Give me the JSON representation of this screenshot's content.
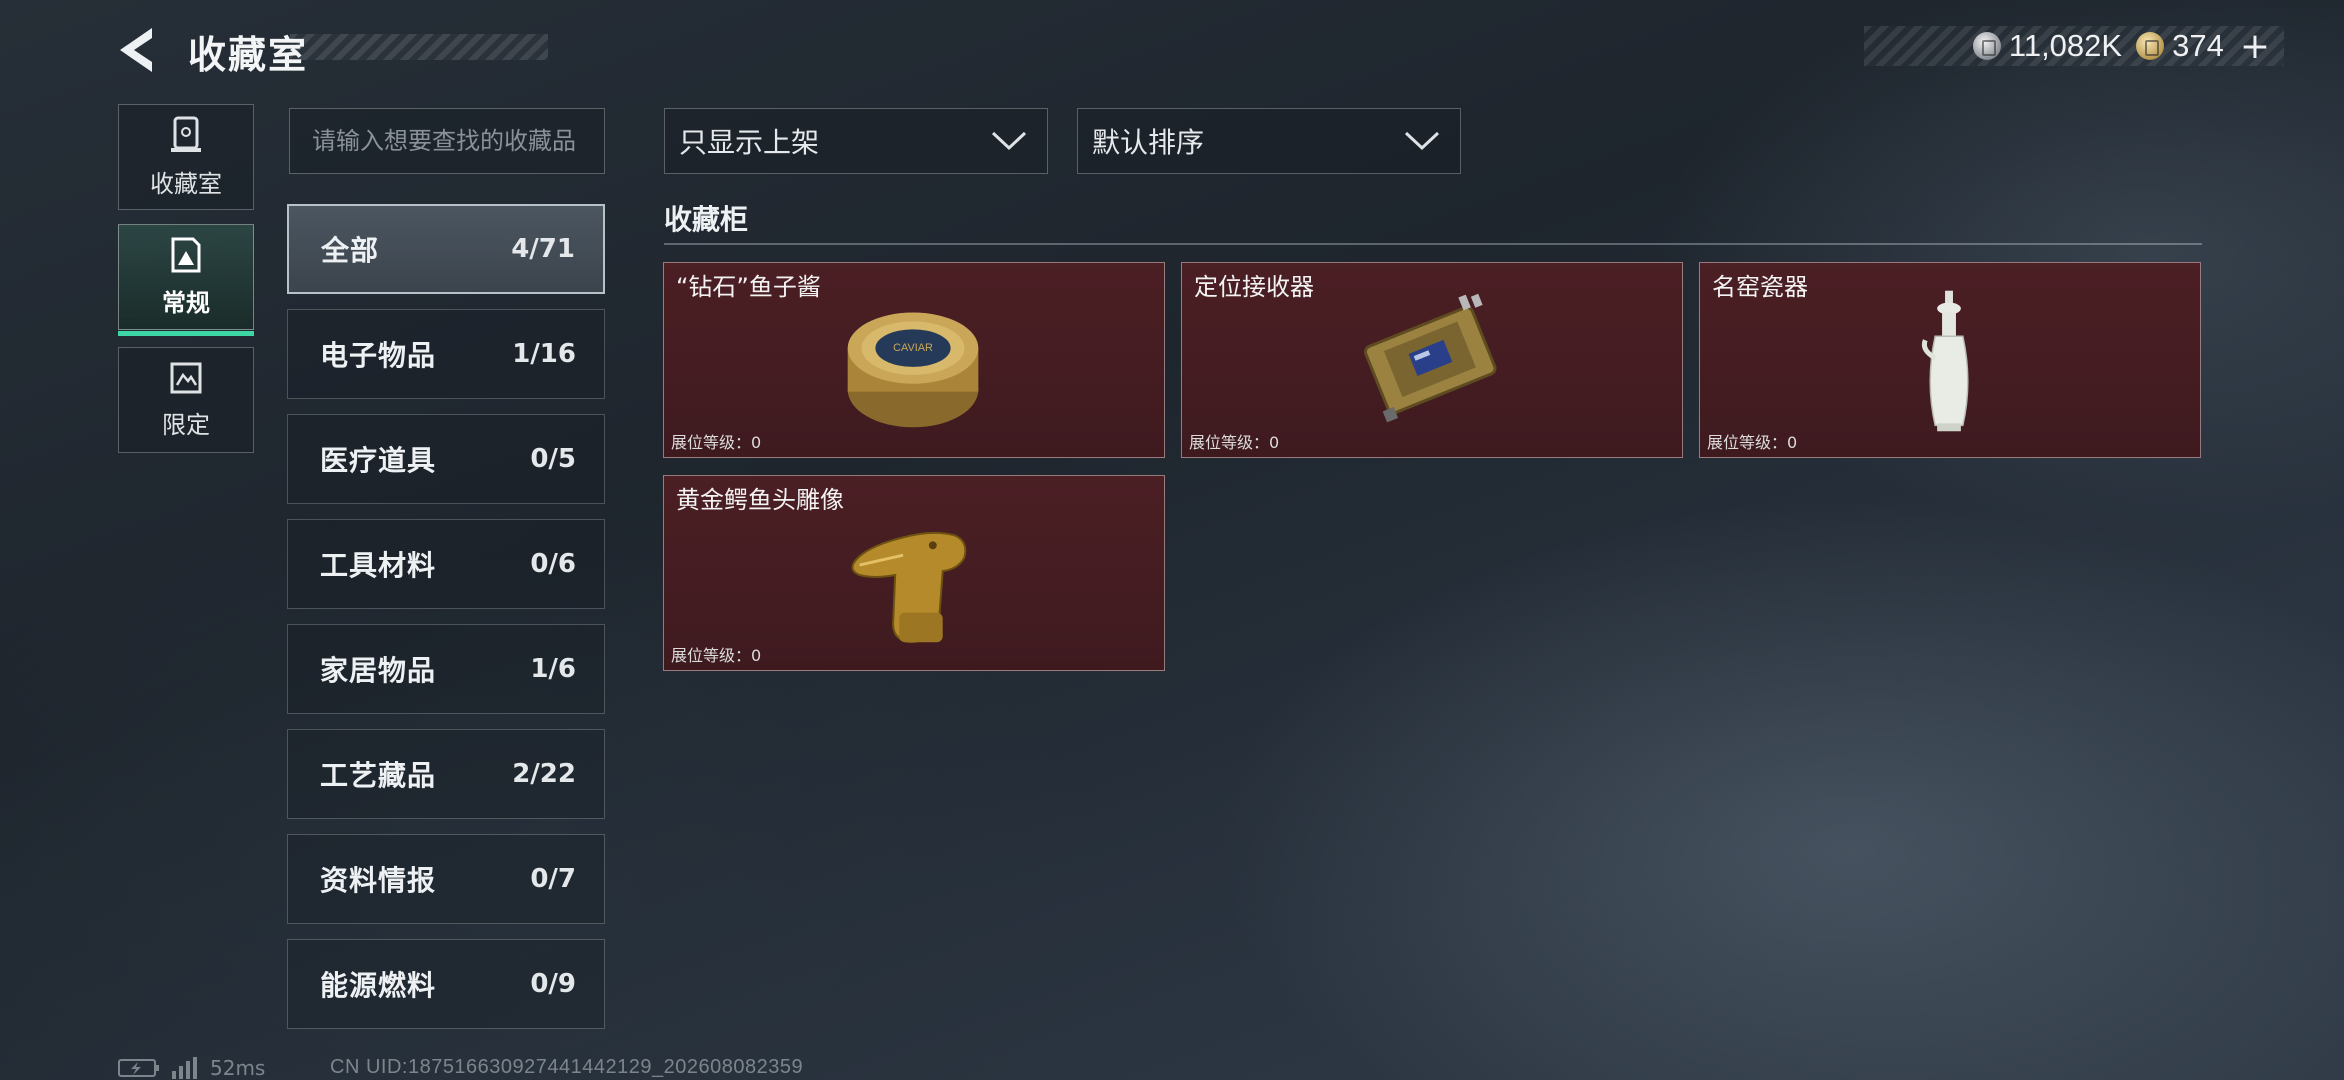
{
  "header": {
    "title": "收藏室",
    "currencies": [
      {
        "icon": "silver-coin-icon",
        "value": "11,082K"
      },
      {
        "icon": "gold-coin-icon",
        "value": "374"
      }
    ],
    "plus_label": "+"
  },
  "left_rail": [
    {
      "label": "收藏室",
      "icon": "collection-room-icon",
      "active": false
    },
    {
      "label": "常规",
      "icon": "regular-icon",
      "active": true
    },
    {
      "label": "限定",
      "icon": "limited-icon",
      "active": false
    }
  ],
  "search": {
    "placeholder": "请输入想要查找的收藏品"
  },
  "categories": [
    {
      "name": "全部",
      "count": "4/71",
      "active": true
    },
    {
      "name": "电子物品",
      "count": "1/16"
    },
    {
      "name": "医疗道具",
      "count": "0/5"
    },
    {
      "name": "工具材料",
      "count": "0/6"
    },
    {
      "name": "家居物品",
      "count": "1/6"
    },
    {
      "name": "工艺藏品",
      "count": "2/22"
    },
    {
      "name": "资料情报",
      "count": "0/7"
    },
    {
      "name": "能源燃料",
      "count": "0/9"
    }
  ],
  "filters": {
    "display_filter": "只显示上架",
    "sort": "默认排序"
  },
  "cabinet": {
    "title": "收藏柜",
    "level_label": "展位等级：",
    "items": [
      {
        "name": "“钻石”鱼子酱",
        "level": "0",
        "icon": "caviar-tin-icon",
        "art_text": "CAVIAR"
      },
      {
        "name": "定位接收器",
        "level": "0",
        "icon": "locator-receiver-icon"
      },
      {
        "name": "名窑瓷器",
        "level": "0",
        "icon": "porcelain-vase-icon"
      },
      {
        "name": "黄金鳄鱼头雕像",
        "level": "0",
        "icon": "golden-crocodile-head-icon"
      }
    ]
  },
  "footer": {
    "ping": "52ms",
    "uid": "CN UID:187516630927441442129_202608082359"
  },
  "colors": {
    "accent_green": "#3fd6a6",
    "card_bg": "#4b1f24",
    "background": "#232b33"
  }
}
